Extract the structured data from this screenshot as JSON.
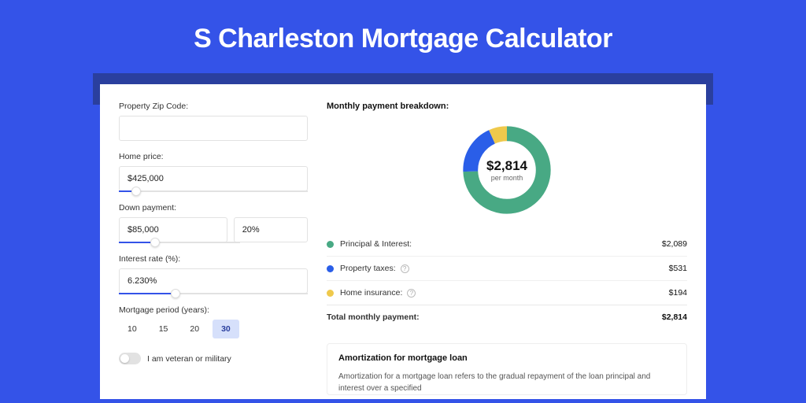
{
  "title": "S Charleston Mortgage Calculator",
  "form": {
    "zip_label": "Property Zip Code:",
    "zip_value": "",
    "price_label": "Home price:",
    "price_value": "$425,000",
    "down_label": "Down payment:",
    "down_value": "$85,000",
    "down_pct": "20%",
    "rate_label": "Interest rate (%):",
    "rate_value": "6.230%",
    "period_label": "Mortgage period (years):",
    "periods": [
      "10",
      "15",
      "20",
      "30"
    ],
    "period_active": "30",
    "veteran_label": "I am veteran or military"
  },
  "breakdown": {
    "title": "Monthly payment breakdown:",
    "center_amount": "$2,814",
    "center_sub": "per month",
    "items": [
      {
        "label": "Principal & Interest:",
        "value": "$2,089",
        "color": "#48a984",
        "help": false
      },
      {
        "label": "Property taxes:",
        "value": "$531",
        "color": "#2a5ee8",
        "help": true
      },
      {
        "label": "Home insurance:",
        "value": "$194",
        "color": "#efc94c",
        "help": true
      }
    ],
    "total_label": "Total monthly payment:",
    "total_value": "$2,814"
  },
  "amortization": {
    "title": "Amortization for mortgage loan",
    "body": "Amortization for a mortgage loan refers to the gradual repayment of the loan principal and interest over a specified"
  },
  "chart_data": {
    "type": "pie",
    "title": "Monthly payment breakdown",
    "series": [
      {
        "name": "Principal & Interest",
        "value": 2089,
        "color": "#48a984"
      },
      {
        "name": "Property taxes",
        "value": 531,
        "color": "#2a5ee8"
      },
      {
        "name": "Home insurance",
        "value": 194,
        "color": "#efc94c"
      }
    ],
    "total": 2814,
    "unit": "USD per month"
  }
}
